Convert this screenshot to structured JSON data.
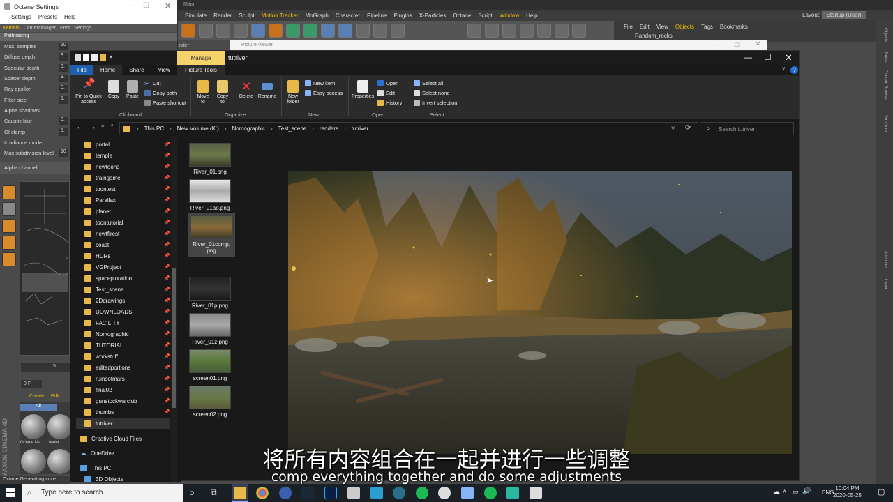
{
  "octane": {
    "title": "Octane Settings",
    "menu": [
      "Settings",
      "Presets",
      "Help"
    ],
    "tabs": [
      "Kernels",
      "Cameraimager",
      "Post",
      "Settings"
    ],
    "section": "Pathtracing",
    "params": [
      {
        "label": "Max. samples",
        "value": "10"
      },
      {
        "label": "Diffuse depth",
        "value": "8."
      },
      {
        "label": "Specular depth",
        "value": "8."
      },
      {
        "label": "Scatter depth",
        "value": "8."
      },
      {
        "label": "Ray epsilon",
        "value": "0."
      },
      {
        "label": "Filter size",
        "value": "1."
      },
      {
        "label": "Alpha shadows",
        "value": ""
      },
      {
        "label": "Caustic blur",
        "value": "0."
      },
      {
        "label": "GI clamp",
        "value": "5."
      },
      {
        "label": "Irradiance mode",
        "value": ""
      },
      {
        "label": "Max subdivision level",
        "value": "10"
      }
    ],
    "alpha_channel": "Alpha channel",
    "status": "Octane:Generating voxe"
  },
  "c4d": {
    "title": "Main",
    "viewport_label": "nder",
    "menubar": [
      "Simulate",
      "Render",
      "Sculpt",
      "Motion Tracker",
      "MoGraph",
      "Character",
      "Pipeline",
      "Plugins",
      "X-Particles",
      "Octane",
      "Script",
      "Window",
      "Help"
    ],
    "highlight_menus": [
      "Motion Tracker",
      "Window"
    ],
    "layout_label": "Layout:",
    "layout_value": "Startup (User)",
    "object_menu": [
      "File",
      "Edit",
      "View",
      "Objects",
      "Tags",
      "Bookmarks"
    ],
    "object_item": "Random_rocks",
    "right_tabs": [
      "Objects",
      "Takes",
      "Content Browser",
      "Structure",
      "Attributes",
      "Layer"
    ],
    "timeline": {
      "start": "0 F",
      "mark": "5"
    },
    "material_menu": [
      "Create",
      "Edit"
    ],
    "material_tab": "All",
    "materials": [
      "Octane Ma",
      "water"
    ],
    "brand": "MAXON CINEMA 4D"
  },
  "picture_viewer": {
    "title": "Picture Viewer"
  },
  "explorer": {
    "folder_name": "tutriver",
    "manage_tab": "Manage",
    "picture_tools_tab": "Picture Tools",
    "tabs": [
      "File",
      "Home",
      "Share",
      "View"
    ],
    "ribbon": {
      "pin": "Pin to Quick access",
      "copy": "Copy",
      "paste": "Paste",
      "cut": "Cut",
      "copy_path": "Copy path",
      "paste_shortcut": "Paste shortcut",
      "clipboard": "Clipboard",
      "move_to": "Move to",
      "copy_to": "Copy to",
      "delete": "Delete",
      "rename": "Rename",
      "organize": "Organize",
      "new_folder": "New folder",
      "new_item": "New item",
      "easy_access": "Easy access",
      "new": "New",
      "properties": "Properties",
      "open_btn": "Open",
      "edit": "Edit",
      "history": "History",
      "open": "Open",
      "select_all": "Select all",
      "select_none": "Select none",
      "invert_selection": "Invert selection",
      "select": "Select"
    },
    "breadcrumb": [
      "This PC",
      "New Volume (K:)",
      "Nomographic",
      "Test_scene",
      "renders",
      "tutriver"
    ],
    "search_placeholder": "Search tutriver",
    "nav_items": [
      "portal",
      "temple",
      "newtoons",
      "traingame",
      "toontest",
      "Parallax",
      "planet",
      "toontutorial",
      "newtfirest",
      "coast",
      "HDRs",
      "VGProject",
      "spaceploration",
      "Test_scene",
      "2Ddrawings",
      "DOWNLOADS",
      "FACILITY",
      "Nomographic",
      "TUTORIAL",
      "workstuff",
      "editedportions",
      "ruinsofmars",
      "final02",
      "gunstockwarclub",
      "thumbs",
      "tutriver"
    ],
    "nav_extra": [
      "Creative Cloud Files",
      "OneDrive",
      "This PC",
      "3D Objects"
    ],
    "files": [
      "River_01.png",
      "River_01ao.png",
      "River_01comp.png",
      "River_01p.png",
      "River_01z.png",
      "screen01.png",
      "screen02.png"
    ]
  },
  "subtitles": {
    "cn": "将所有内容组合在一起并进行一些调整",
    "en": "comp everything together and do some adjustments"
  },
  "taskbar": {
    "search_placeholder": "Type here to search",
    "language": "ENG",
    "time": "10:04 PM",
    "date": "2020-05-25"
  }
}
